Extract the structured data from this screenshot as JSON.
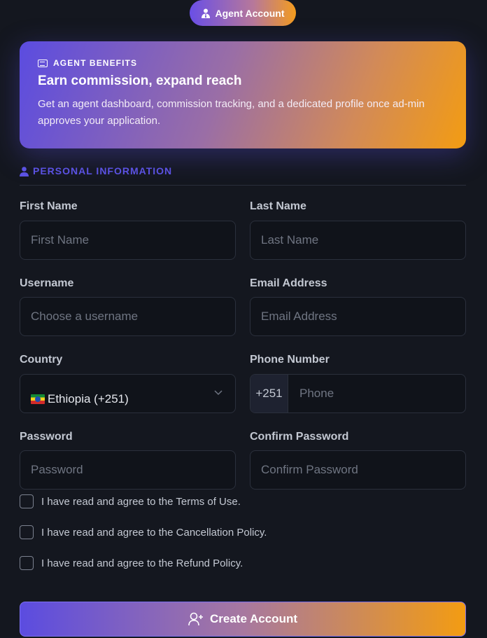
{
  "header": {
    "pill_label": "Agent Account",
    "pill_icon": "user-tie-icon"
  },
  "banner": {
    "kicker": "AGENT BENEFITS",
    "kicker_icon": "id-card-icon",
    "title": "Earn commission, expand reach",
    "description": "Get an agent dashboard, commission tracking, and a dedicated profile once ad-min approves your application."
  },
  "section": {
    "title": "PERSONAL INFORMATION",
    "icon": "user-icon"
  },
  "form": {
    "first_name": {
      "label": "First Name",
      "placeholder": "First Name",
      "value": ""
    },
    "last_name": {
      "label": "Last Name",
      "placeholder": "Last Name",
      "value": ""
    },
    "username": {
      "label": "Username",
      "placeholder": "Choose a username",
      "value": ""
    },
    "email": {
      "label": "Email Address",
      "placeholder": "Email Address",
      "value": ""
    },
    "country": {
      "label": "Country",
      "selected": "Ethiopia (+251)"
    },
    "phone": {
      "label": "Phone Number",
      "prefix": "+251",
      "placeholder": "Phone",
      "value": ""
    },
    "password": {
      "label": "Password",
      "placeholder": "Password"
    },
    "confirm_password": {
      "label": "Confirm Password",
      "placeholder": "Confirm Password"
    }
  },
  "agreements": [
    {
      "label": "I have read and agree to the Terms of Use.",
      "checked": false
    },
    {
      "label": "I have read and agree to the Cancellation Policy.",
      "checked": false
    },
    {
      "label": "I have read and agree to the Refund Policy.",
      "checked": false
    }
  ],
  "submit": {
    "label": "Create Account",
    "icon": "user-plus-icon"
  },
  "colors": {
    "accent_purple": "#5b4ce0",
    "accent_orange": "#f39c12",
    "background": "#14171f",
    "input_bg": "#10131a"
  }
}
